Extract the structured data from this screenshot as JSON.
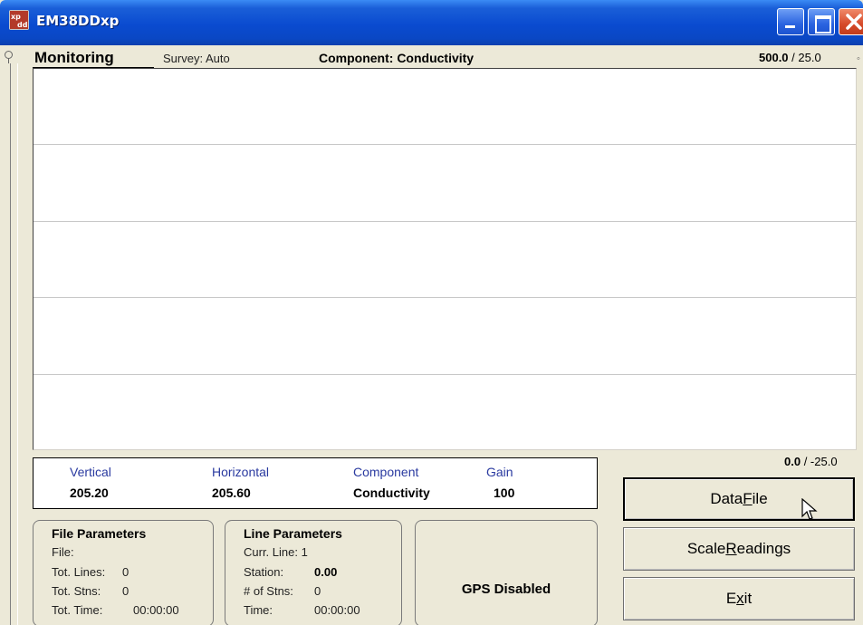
{
  "window": {
    "title": "EM38DDxp",
    "icon": "em38-app-icon",
    "controls": [
      "minimize-icon",
      "maximize-icon",
      "close-icon"
    ]
  },
  "header": {
    "mode": "Monitoring",
    "survey": "Survey: Auto",
    "component": "Component: Conductivity",
    "scale_top_max": "500.0",
    "scale_top_sep": " / ",
    "scale_top_min": "25.0",
    "scale_bottom_max": "0.0",
    "scale_bottom_sep": " / ",
    "scale_bottom_min": "-25.0"
  },
  "readings": {
    "labels": [
      "Vertical",
      "Horizontal",
      "Component",
      "Gain"
    ],
    "values": [
      "205.20",
      "205.60",
      "Conductivity",
      "100"
    ]
  },
  "file_parameters": {
    "title": "File Parameters",
    "file_label": "File:",
    "file_value": "",
    "lines_label": "Tot. Lines:",
    "lines_value": "0",
    "stns_label": "Tot. Stns:",
    "stns_value": "0",
    "time_label": "Tot. Time:",
    "time_value": "00:00:00"
  },
  "line_parameters": {
    "title": "Line Parameters",
    "curr_line": "Curr. Line: 1",
    "station_label": "Station:",
    "station_value": "0.00",
    "num_stns_label": "# of Stns:",
    "num_stns_value": "0",
    "time_label": "Time:",
    "time_value": "00:00:00"
  },
  "gps": {
    "status": "GPS Disabled"
  },
  "buttons": {
    "data_file_pre": "Data ",
    "data_file_key": "F",
    "data_file_post": "ile",
    "scale_pre": "Scale ",
    "scale_key": "R",
    "scale_post": "eadings",
    "exit_pre": "E",
    "exit_key": "x",
    "exit_post": "it"
  },
  "colors": {
    "titlebar": "#0a47c4",
    "reading_label": "#2a3aa0",
    "panel": "#ece9d8",
    "plot_bg": "#ffffff"
  }
}
